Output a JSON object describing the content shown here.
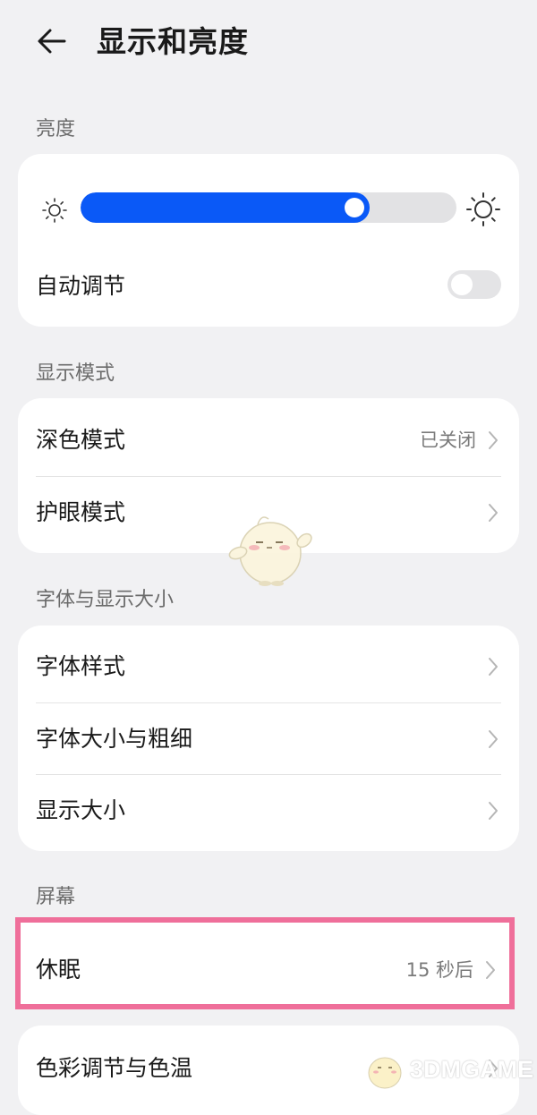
{
  "header": {
    "back_icon": "arrow-left-icon",
    "title": "显示和亮度"
  },
  "brightness": {
    "section_label": "亮度",
    "level": 0.77,
    "accent_color": "#0a59f7",
    "min_icon": "sun-small-icon",
    "max_icon": "sun-large-icon",
    "auto_label": "自动调节",
    "auto_enabled": false
  },
  "display_mode": {
    "section_label": "显示模式",
    "dark_mode_label": "深色模式",
    "dark_mode_value": "已关闭",
    "eye_comfort_label": "护眼模式"
  },
  "font_size": {
    "section_label": "字体与显示大小",
    "font_style_label": "字体样式",
    "font_size_weight_label": "字体大小与粗细",
    "display_size_label": "显示大小"
  },
  "screen": {
    "section_label": "屏幕",
    "sleep_label": "休眠",
    "sleep_value": "15 秒后",
    "color_temp_label": "色彩调节与色温"
  },
  "watermark": {
    "text": "3DMGAME",
    "highlight_color": "#ef6f9a"
  }
}
